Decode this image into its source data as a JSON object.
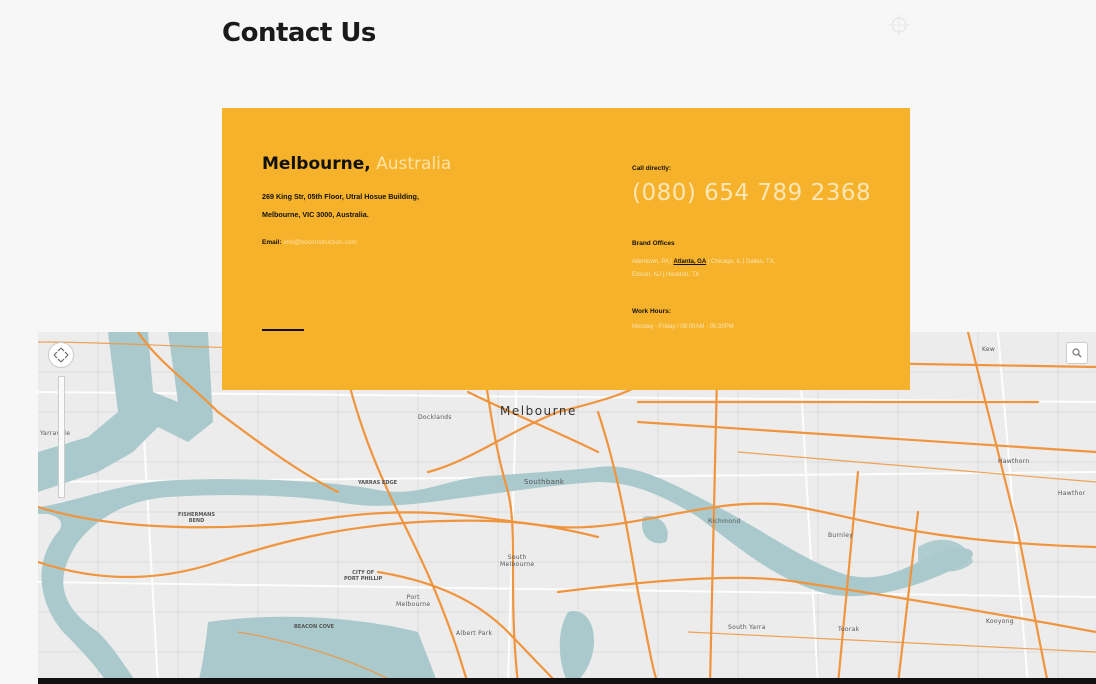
{
  "page": {
    "title": "Contact Us"
  },
  "card": {
    "city": "Melbourne,",
    "country": "Australia",
    "address_line1": "269 King Str, 05th Floor, Utral Hosue Building,",
    "address_line2": "Melbourne, VIC 3000, Australia.",
    "email_label": "Email:",
    "email_value": "info@boconstruction.com",
    "call_label": "Call directly:",
    "phone": "(080) 654 789 2368",
    "brand_label": "Brand Offices",
    "offices_pre": "Allentown, PA | ",
    "offices_highlight": "Atlanta, GA",
    "offices_post": " | Chicago, IL | Dallas, TX,",
    "offices_line2": "Edison, NJ | Houston, TX",
    "hours_label": "Work Hours:",
    "hours_value": "Monday - Friday / 08:00AM - 05:30PM"
  },
  "map": {
    "labels": {
      "melbourne": "Melbourne",
      "southbank": "Southbank",
      "docklands": "Docklands",
      "south_melbourne": "South\nMelbourne",
      "port_melbourne": "Port\nMelbourne",
      "city_port_phillip": "CITY OF\nPORT PHILLIP",
      "albert_park": "Albert Park",
      "south_yarra": "South Yarra",
      "toorak": "Toorak",
      "richmond": "Richmond",
      "burnley": "Burnley",
      "hawthorn": "Hawthorn",
      "hawthorn_east": "Hawthor",
      "kooyong": "Kooyong",
      "kew": "Kew",
      "yarraville": "Yarraville",
      "fishermans_bend": "FISHERMANS\nBEND",
      "beacon_cove": "BEACON COVE",
      "yarras_edge": "YARRAS EDGE"
    },
    "icons": {
      "pan": "pan-icon",
      "search": "magnifier-icon",
      "corner": "crosshair-icon"
    }
  },
  "colors": {
    "card_bg": "#f6b22a",
    "road": "#f0943d",
    "water": "#a9c9cc",
    "map_bg": "#ececec"
  }
}
